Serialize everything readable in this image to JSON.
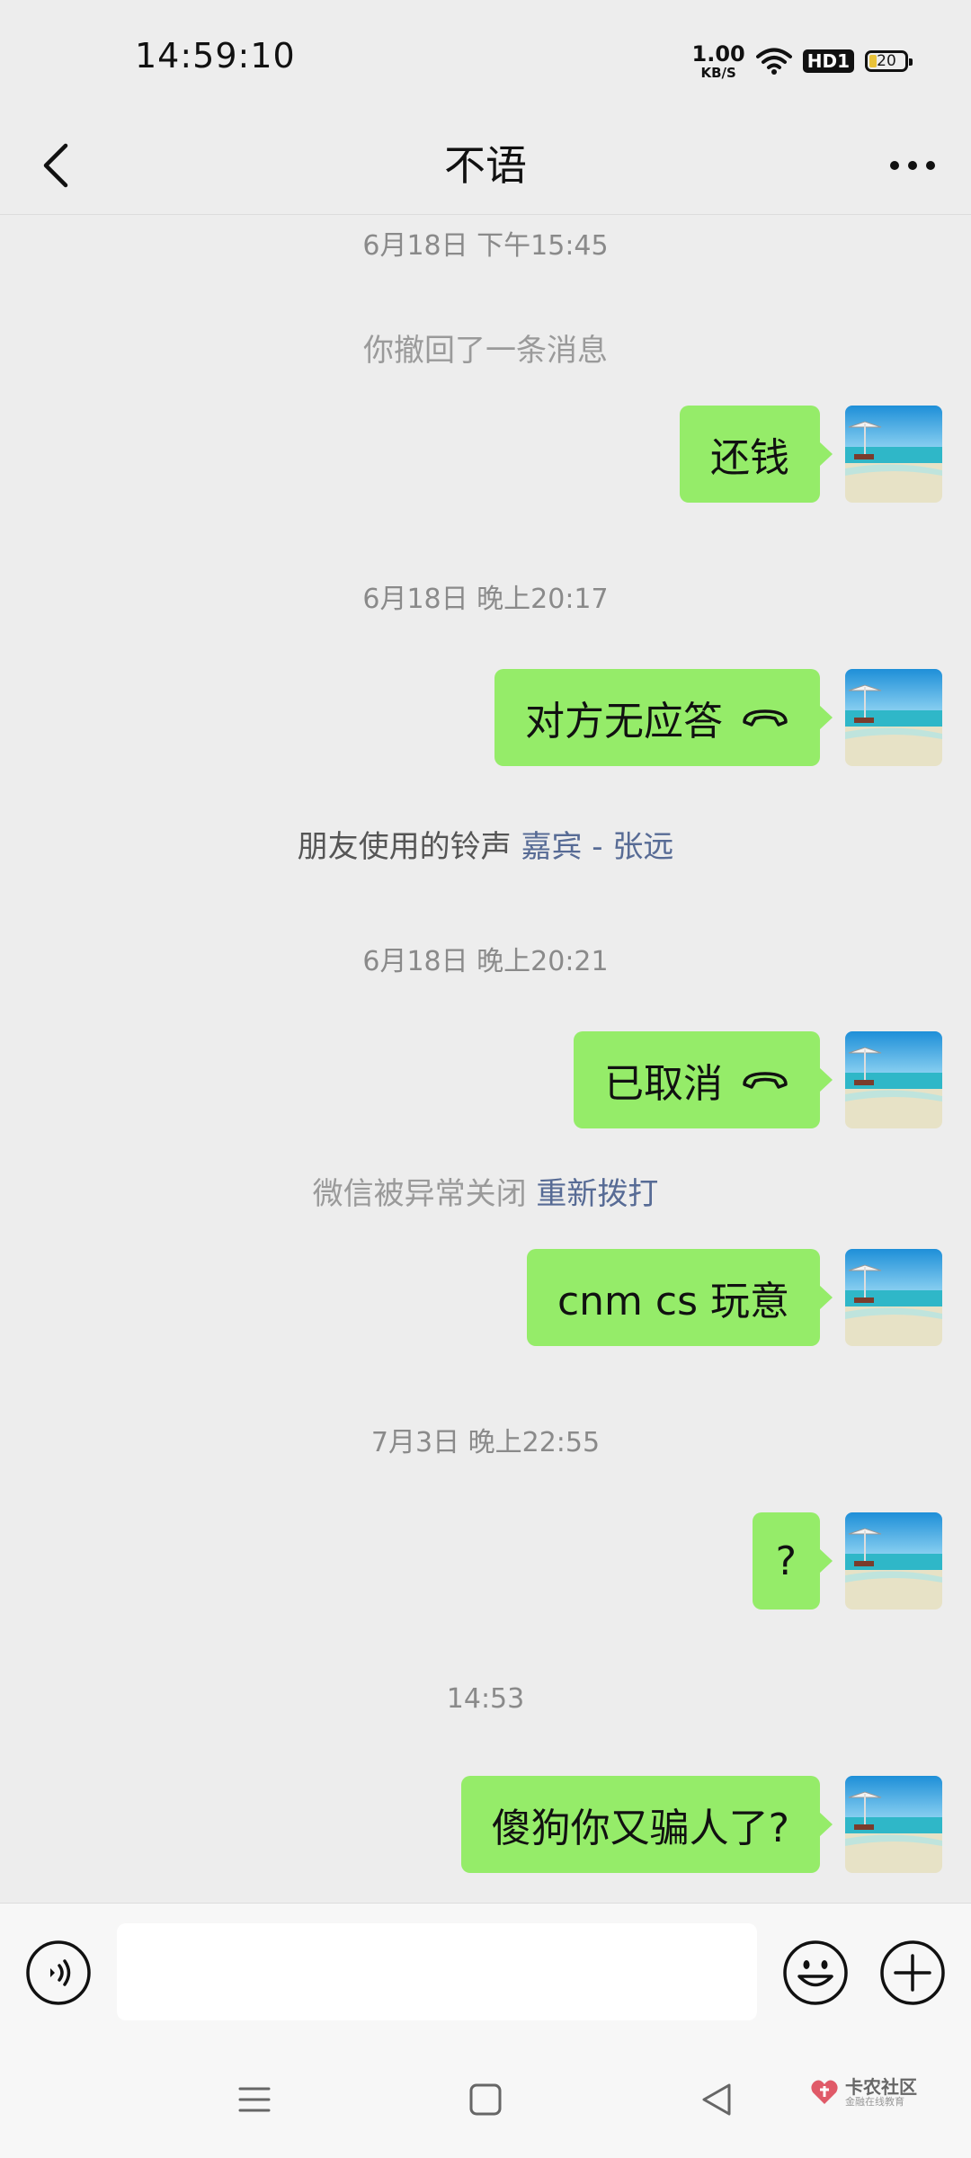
{
  "status_bar": {
    "time": "14:59:10",
    "net_speed_value": "1.00",
    "net_speed_unit": "KB/S",
    "hd_label": "HD1",
    "battery_level": "20",
    "battery_color": "#e8c23a"
  },
  "header": {
    "title": "不语",
    "back_icon": "chevron-left-icon",
    "more_icon": "more-dots-icon"
  },
  "messages": {
    "ts1": "6月18日 下午15:45",
    "sys_recall": "你撤回了一条消息",
    "msg1": "还钱",
    "ts2": "6月18日 晚上20:17",
    "msg2": "对方无应答",
    "ringtone_prefix": "朋友使用的铃声",
    "ringtone_song": "嘉宾 - 张远",
    "ts3": "6月18日 晚上20:21",
    "msg3": "已取消",
    "sys_closed": "微信被异常关闭",
    "redial": "重新拨打",
    "msg4": "cnm  cs 玩意",
    "ts4": "7月3日 晚上22:55",
    "msg5": "?",
    "ts5": "14:53",
    "msg6": "傻狗你又骗人了?"
  },
  "input_bar": {
    "value": "",
    "voice_icon": "voice-icon",
    "emoji_icon": "emoji-icon",
    "plus_icon": "plus-icon"
  },
  "watermark": {
    "main": "卡农社区",
    "sub": "金融在线教育"
  },
  "colors": {
    "bubble": "#95ec69",
    "background": "#ededed",
    "link": "#576b95"
  }
}
